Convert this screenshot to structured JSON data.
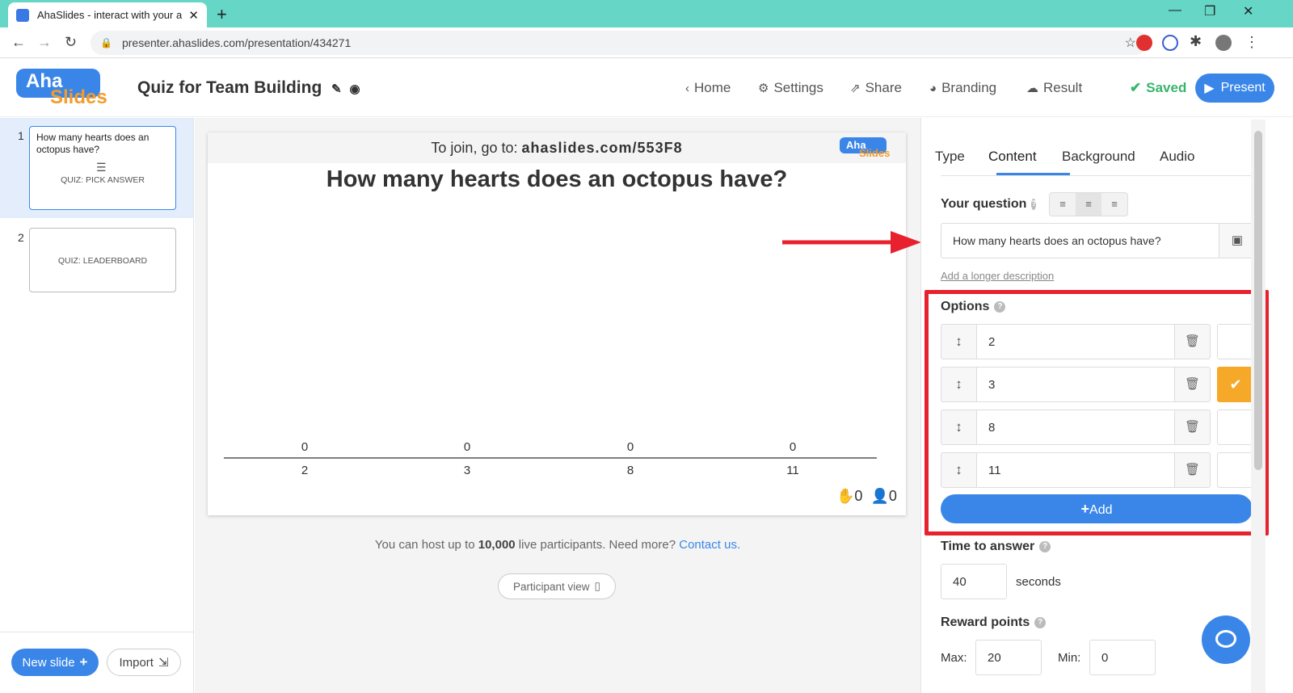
{
  "browser": {
    "tab_title": "AhaSlides - interact with your au",
    "url": "presenter.ahaslides.com/presentation/434271"
  },
  "header": {
    "logo_top": "Aha",
    "logo_bottom": "Slides",
    "title": "Quiz for Team Building",
    "nav": {
      "home": "Home",
      "settings": "Settings",
      "share": "Share",
      "branding": "Branding",
      "result": "Result",
      "saved": "Saved",
      "present": "Present"
    }
  },
  "sidebar": {
    "slides": [
      {
        "num": "1",
        "question": "How many hearts does an octopus have?",
        "kind": "QUIZ: PICK ANSWER",
        "selected": true
      },
      {
        "num": "2",
        "question": "",
        "kind": "QUIZ: LEADERBOARD",
        "selected": false
      }
    ],
    "new_slide": "New slide",
    "import": "Import"
  },
  "slide": {
    "join_prefix": "To join, go to: ",
    "join_url": "ahaslides.com/553F8",
    "question": "How many hearts does an octopus have?",
    "reactions_count": "0",
    "participants_count": "0"
  },
  "chart_data": {
    "type": "bar",
    "categories": [
      "2",
      "3",
      "8",
      "11"
    ],
    "values": [
      0,
      0,
      0,
      0
    ],
    "title": "",
    "xlabel": "",
    "ylabel": ""
  },
  "footer": {
    "host_pre": "You can host up to ",
    "host_num": "10,000",
    "host_post": " live participants. Need more? ",
    "contact": "Contact us.",
    "participant_view": "Participant view"
  },
  "panel": {
    "tabs": [
      "Type",
      "Content",
      "Background",
      "Audio"
    ],
    "active_tab": "Content",
    "your_question_label": "Your question",
    "question_value": "How many hearts does an octopus have?",
    "longer_desc": "Add a longer description",
    "options_label": "Options",
    "options": [
      {
        "value": "2",
        "correct": false
      },
      {
        "value": "3",
        "correct": true
      },
      {
        "value": "8",
        "correct": false
      },
      {
        "value": "11",
        "correct": false
      }
    ],
    "add_label": "Add",
    "time_label": "Time to answer",
    "time_value": "40",
    "time_unit": "seconds",
    "reward_label": "Reward points",
    "max_label": "Max:",
    "max_value": "20",
    "min_label": "Min:",
    "min_value": "0"
  },
  "colors": {
    "accent": "#3a86e8",
    "correct": "#f6a828",
    "highlight": "#e8212e",
    "tabbar": "#66d6c6"
  }
}
